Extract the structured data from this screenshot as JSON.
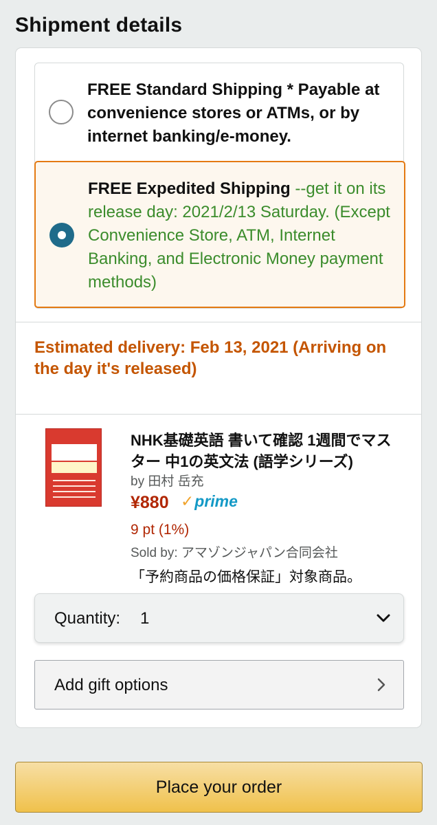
{
  "page": {
    "section_title": "Shipment details"
  },
  "shipping_options": {
    "standard": {
      "label": "FREE Standard Shipping * Payable at convenience stores or ATMs, or by internet banking/e-money.",
      "selected": false
    },
    "expedited": {
      "title": "FREE Expedited Shipping",
      "detail": " --get it on its release day: 2021/2/13 Saturday. (Except Convenience Store, ATM, Internet Banking, and Electronic Money payment methods)",
      "selected": true
    }
  },
  "delivery": {
    "estimate": "Estimated delivery: Feb 13, 2021 (Arriving on the day it's released)"
  },
  "product": {
    "title": "NHK基礎英語 書いて確認 1週間でマスター 中1の英文法 (語学シリーズ)",
    "author": "by 田村 岳充",
    "price": "¥880",
    "prime_label": "prime",
    "points": "9 pt (1%)",
    "seller": "Sold by: アマゾンジャパン合同会社",
    "guarantee": "「予約商品の価格保証」対象商品。"
  },
  "quantity": {
    "label": "Quantity:",
    "value": "1"
  },
  "gift": {
    "label": "Add gift options"
  },
  "order_button": {
    "label": "Place your order"
  },
  "colors": {
    "accent_orange": "#e47911",
    "delivery_text": "#c45500",
    "green_text": "#3b8c2c",
    "price_red": "#b12704",
    "radio_selected": "#1f6b8a",
    "prime_blue": "#1399c6",
    "button_yellow": "#f0c14b"
  },
  "icons": {
    "radio_unselected": "radio-empty-icon",
    "radio_selected": "radio-selected-icon",
    "prime_check": "check-icon",
    "quantity_dropdown": "chevron-down-icon",
    "gift_chevron": "chevron-right-icon"
  }
}
